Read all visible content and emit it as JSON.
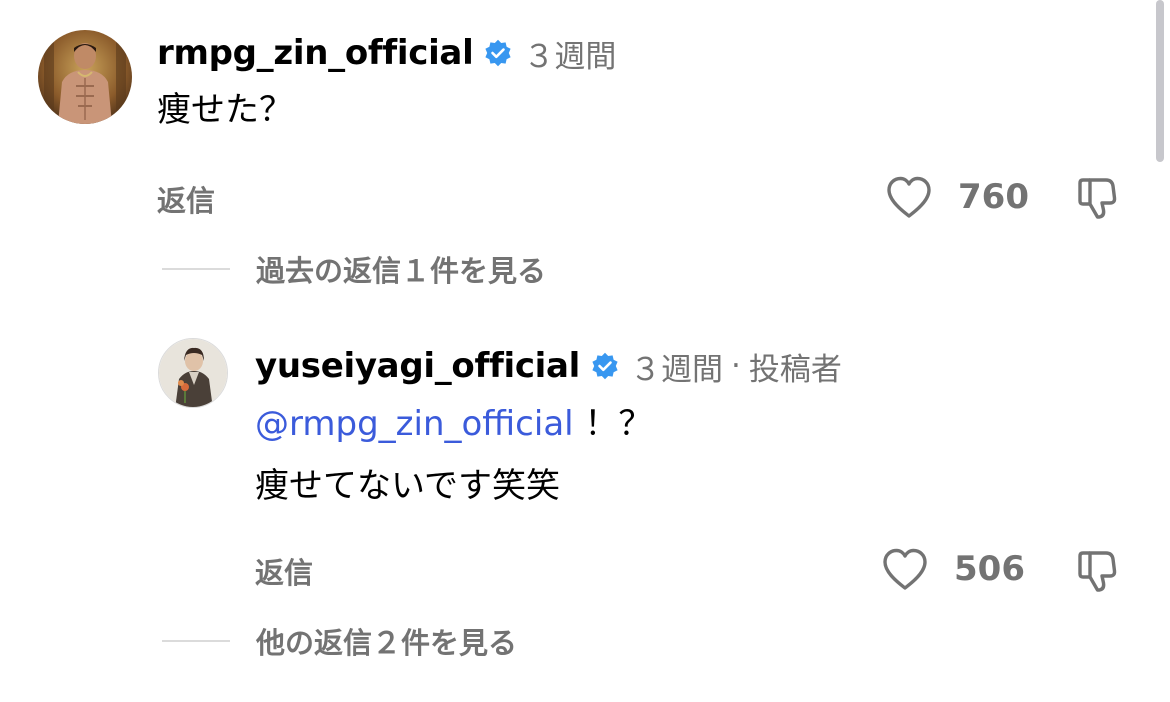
{
  "comment": {
    "username": "rmpg_zin_official",
    "verified": true,
    "time": "３週間",
    "text": "痩せた？",
    "reply_label": "返信",
    "like_count": "760",
    "view_replies": "過去の返信１件を見る"
  },
  "reply": {
    "username": "yuseiyagi_official",
    "verified": true,
    "time": "３週間",
    "separator": "·",
    "author_label": "投稿者",
    "mention": "@rmpg_zin_official",
    "text_after_mention": " ！？",
    "text_line2": "痩せてないです笑笑",
    "reply_label": "返信",
    "like_count": "506",
    "view_replies": "他の返信２件を見る"
  },
  "colors": {
    "verified_badge": "#3897f0",
    "mention": "#3b5bdb",
    "secondary_text": "#737373"
  },
  "icons": {
    "verified": "verified-badge-icon",
    "like": "heart-icon",
    "dislike": "thumbs-down-icon"
  }
}
